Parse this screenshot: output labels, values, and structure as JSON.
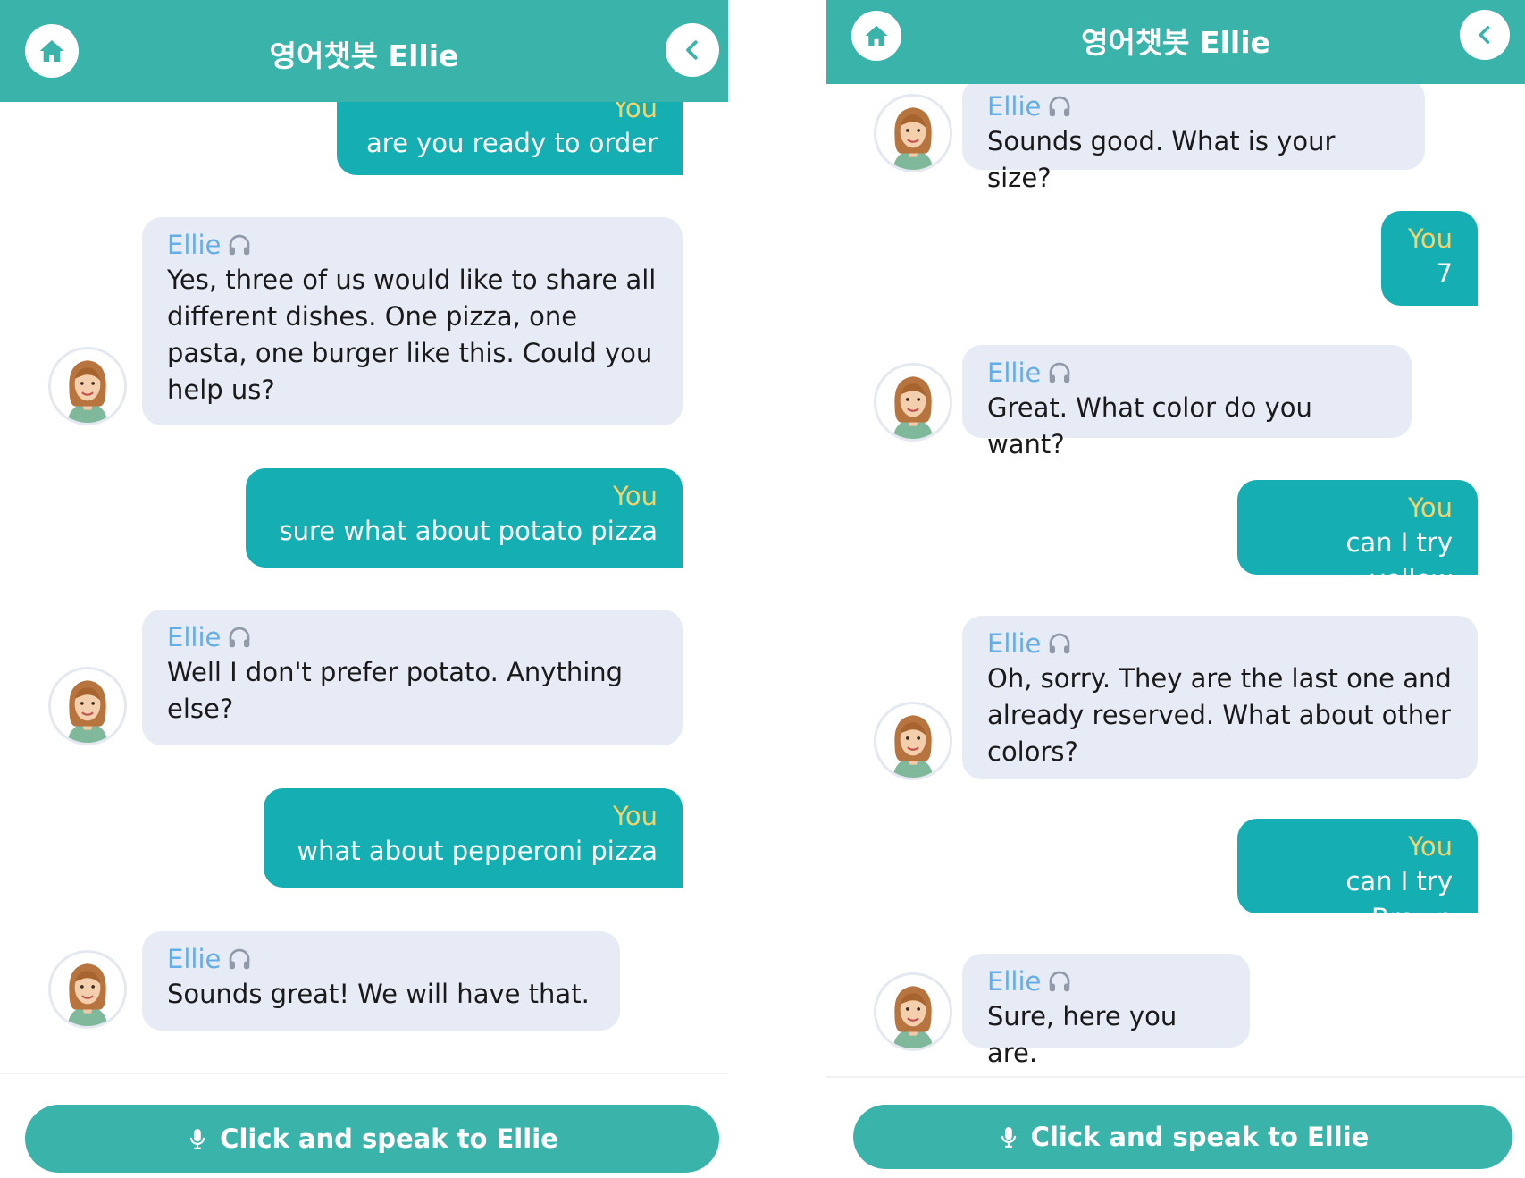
{
  "colors": {
    "header": "#3ab3ab",
    "user_bubble": "#14aeb3",
    "bot_bubble": "#e7ebf5",
    "bot_name": "#64aee8",
    "user_name": "#f3d46a"
  },
  "left": {
    "header": {
      "title": "영어챗봇 Ellie",
      "home_icon": "home-icon",
      "back_icon": "chevron-left-icon"
    },
    "messages": [
      {
        "sender": "You",
        "text": "are you ready to order"
      },
      {
        "sender": "Ellie",
        "text": "Yes, three of us would like to share all different dishes. One pizza, one pasta, one burger like this. Could you help us?"
      },
      {
        "sender": "You",
        "text": "sure what about potato pizza"
      },
      {
        "sender": "Ellie",
        "text": "Well I don't prefer potato. Anything else?"
      },
      {
        "sender": "You",
        "text": "what about pepperoni pizza"
      },
      {
        "sender": "Ellie",
        "text": "Sounds great! We will have that."
      }
    ],
    "speak_button": {
      "label": "Click and speak to Ellie",
      "icon": "microphone-icon"
    }
  },
  "right": {
    "header": {
      "title": "영어챗봇 Ellie",
      "home_icon": "home-icon",
      "back_icon": "chevron-left-icon"
    },
    "messages": [
      {
        "sender": "Ellie",
        "text": "Sounds good. What is your size?"
      },
      {
        "sender": "You",
        "text": "7"
      },
      {
        "sender": "Ellie",
        "text": "Great. What color do you want?"
      },
      {
        "sender": "You",
        "text": "can I try yellow"
      },
      {
        "sender": "Ellie",
        "text": "Oh, sorry. They are the last one and already reserved. What about other colors?"
      },
      {
        "sender": "You",
        "text": "can I try Brown"
      },
      {
        "sender": "Ellie",
        "text": "Sure, here you are."
      }
    ],
    "speak_button": {
      "label": "Click and speak to Ellie",
      "icon": "microphone-icon"
    }
  }
}
